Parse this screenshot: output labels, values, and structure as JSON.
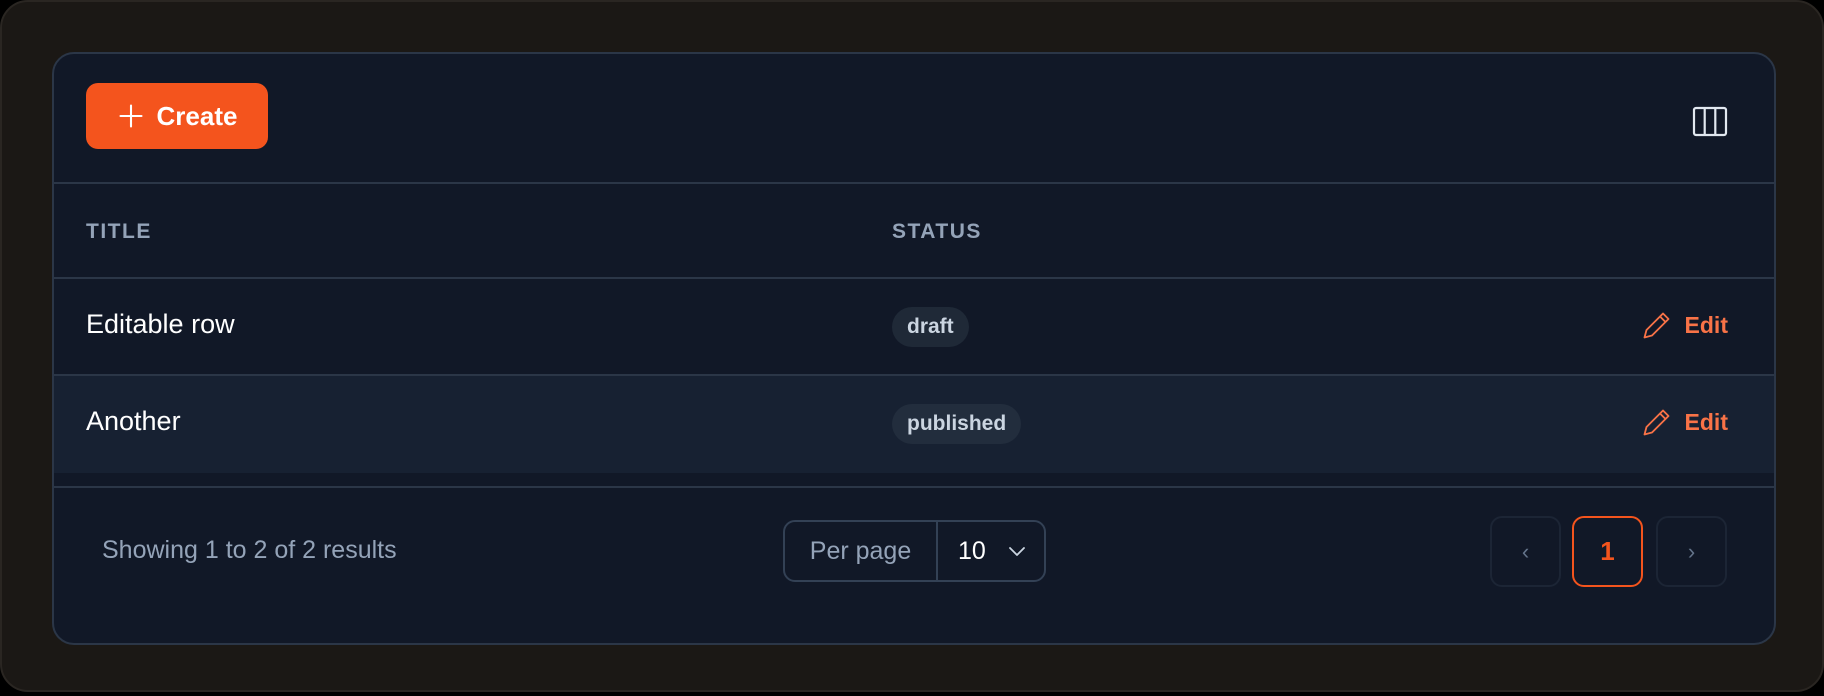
{
  "toolbar": {
    "create_label": "Create",
    "create_icon": "plus-icon",
    "columns_icon": "columns-icon"
  },
  "table": {
    "columns": [
      "TITLE",
      "STATUS"
    ],
    "rows": [
      {
        "title": "Editable row",
        "status": "draft",
        "action": "Edit"
      },
      {
        "title": "Another",
        "status": "published",
        "action": "Edit"
      }
    ]
  },
  "footer": {
    "summary": "Showing 1 to 2 of 2 results",
    "per_page_label": "Per page",
    "per_page_value": "10",
    "pagination": {
      "prev": "‹",
      "current": "1",
      "next": "›"
    }
  },
  "colors": {
    "accent": "#f4541d",
    "edit_link": "#f97347",
    "card_bg": "#111827",
    "badge_bg": "#1f2937"
  }
}
